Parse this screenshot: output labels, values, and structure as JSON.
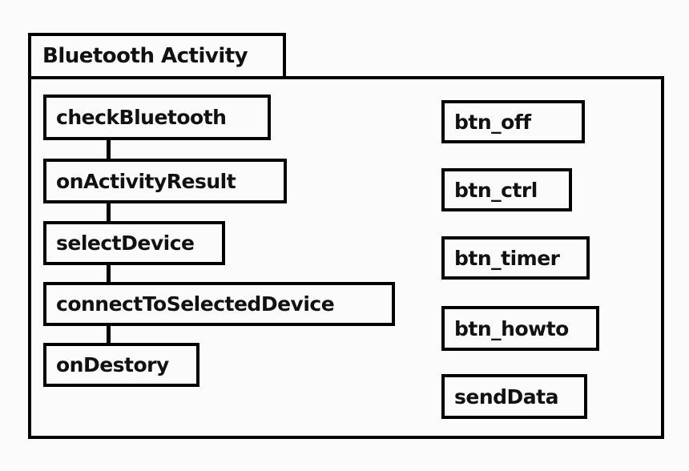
{
  "title": "Bluetooth Activity",
  "methods": [
    "checkBluetooth",
    "onActivityResult",
    "selectDevice",
    "connectToSelectedDevice",
    "onDestory"
  ],
  "buttons": [
    "btn_off",
    "btn_ctrl",
    "btn_timer",
    "btn_howto",
    "sendData"
  ]
}
